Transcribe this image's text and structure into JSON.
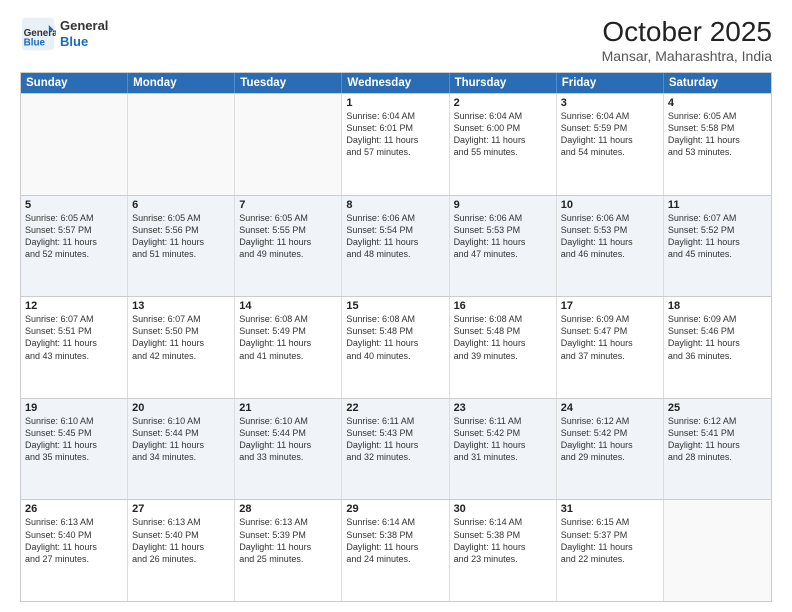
{
  "logo": {
    "line1": "General",
    "line2": "Blue"
  },
  "title": "October 2025",
  "subtitle": "Mansar, Maharashtra, India",
  "days": [
    "Sunday",
    "Monday",
    "Tuesday",
    "Wednesday",
    "Thursday",
    "Friday",
    "Saturday"
  ],
  "weeks": [
    [
      {
        "day": "",
        "info": ""
      },
      {
        "day": "",
        "info": ""
      },
      {
        "day": "",
        "info": ""
      },
      {
        "day": "1",
        "info": "Sunrise: 6:04 AM\nSunset: 6:01 PM\nDaylight: 11 hours\nand 57 minutes."
      },
      {
        "day": "2",
        "info": "Sunrise: 6:04 AM\nSunset: 6:00 PM\nDaylight: 11 hours\nand 55 minutes."
      },
      {
        "day": "3",
        "info": "Sunrise: 6:04 AM\nSunset: 5:59 PM\nDaylight: 11 hours\nand 54 minutes."
      },
      {
        "day": "4",
        "info": "Sunrise: 6:05 AM\nSunset: 5:58 PM\nDaylight: 11 hours\nand 53 minutes."
      }
    ],
    [
      {
        "day": "5",
        "info": "Sunrise: 6:05 AM\nSunset: 5:57 PM\nDaylight: 11 hours\nand 52 minutes."
      },
      {
        "day": "6",
        "info": "Sunrise: 6:05 AM\nSunset: 5:56 PM\nDaylight: 11 hours\nand 51 minutes."
      },
      {
        "day": "7",
        "info": "Sunrise: 6:05 AM\nSunset: 5:55 PM\nDaylight: 11 hours\nand 49 minutes."
      },
      {
        "day": "8",
        "info": "Sunrise: 6:06 AM\nSunset: 5:54 PM\nDaylight: 11 hours\nand 48 minutes."
      },
      {
        "day": "9",
        "info": "Sunrise: 6:06 AM\nSunset: 5:53 PM\nDaylight: 11 hours\nand 47 minutes."
      },
      {
        "day": "10",
        "info": "Sunrise: 6:06 AM\nSunset: 5:53 PM\nDaylight: 11 hours\nand 46 minutes."
      },
      {
        "day": "11",
        "info": "Sunrise: 6:07 AM\nSunset: 5:52 PM\nDaylight: 11 hours\nand 45 minutes."
      }
    ],
    [
      {
        "day": "12",
        "info": "Sunrise: 6:07 AM\nSunset: 5:51 PM\nDaylight: 11 hours\nand 43 minutes."
      },
      {
        "day": "13",
        "info": "Sunrise: 6:07 AM\nSunset: 5:50 PM\nDaylight: 11 hours\nand 42 minutes."
      },
      {
        "day": "14",
        "info": "Sunrise: 6:08 AM\nSunset: 5:49 PM\nDaylight: 11 hours\nand 41 minutes."
      },
      {
        "day": "15",
        "info": "Sunrise: 6:08 AM\nSunset: 5:48 PM\nDaylight: 11 hours\nand 40 minutes."
      },
      {
        "day": "16",
        "info": "Sunrise: 6:08 AM\nSunset: 5:48 PM\nDaylight: 11 hours\nand 39 minutes."
      },
      {
        "day": "17",
        "info": "Sunrise: 6:09 AM\nSunset: 5:47 PM\nDaylight: 11 hours\nand 37 minutes."
      },
      {
        "day": "18",
        "info": "Sunrise: 6:09 AM\nSunset: 5:46 PM\nDaylight: 11 hours\nand 36 minutes."
      }
    ],
    [
      {
        "day": "19",
        "info": "Sunrise: 6:10 AM\nSunset: 5:45 PM\nDaylight: 11 hours\nand 35 minutes."
      },
      {
        "day": "20",
        "info": "Sunrise: 6:10 AM\nSunset: 5:44 PM\nDaylight: 11 hours\nand 34 minutes."
      },
      {
        "day": "21",
        "info": "Sunrise: 6:10 AM\nSunset: 5:44 PM\nDaylight: 11 hours\nand 33 minutes."
      },
      {
        "day": "22",
        "info": "Sunrise: 6:11 AM\nSunset: 5:43 PM\nDaylight: 11 hours\nand 32 minutes."
      },
      {
        "day": "23",
        "info": "Sunrise: 6:11 AM\nSunset: 5:42 PM\nDaylight: 11 hours\nand 31 minutes."
      },
      {
        "day": "24",
        "info": "Sunrise: 6:12 AM\nSunset: 5:42 PM\nDaylight: 11 hours\nand 29 minutes."
      },
      {
        "day": "25",
        "info": "Sunrise: 6:12 AM\nSunset: 5:41 PM\nDaylight: 11 hours\nand 28 minutes."
      }
    ],
    [
      {
        "day": "26",
        "info": "Sunrise: 6:13 AM\nSunset: 5:40 PM\nDaylight: 11 hours\nand 27 minutes."
      },
      {
        "day": "27",
        "info": "Sunrise: 6:13 AM\nSunset: 5:40 PM\nDaylight: 11 hours\nand 26 minutes."
      },
      {
        "day": "28",
        "info": "Sunrise: 6:13 AM\nSunset: 5:39 PM\nDaylight: 11 hours\nand 25 minutes."
      },
      {
        "day": "29",
        "info": "Sunrise: 6:14 AM\nSunset: 5:38 PM\nDaylight: 11 hours\nand 24 minutes."
      },
      {
        "day": "30",
        "info": "Sunrise: 6:14 AM\nSunset: 5:38 PM\nDaylight: 11 hours\nand 23 minutes."
      },
      {
        "day": "31",
        "info": "Sunrise: 6:15 AM\nSunset: 5:37 PM\nDaylight: 11 hours\nand 22 minutes."
      },
      {
        "day": "",
        "info": ""
      }
    ]
  ]
}
